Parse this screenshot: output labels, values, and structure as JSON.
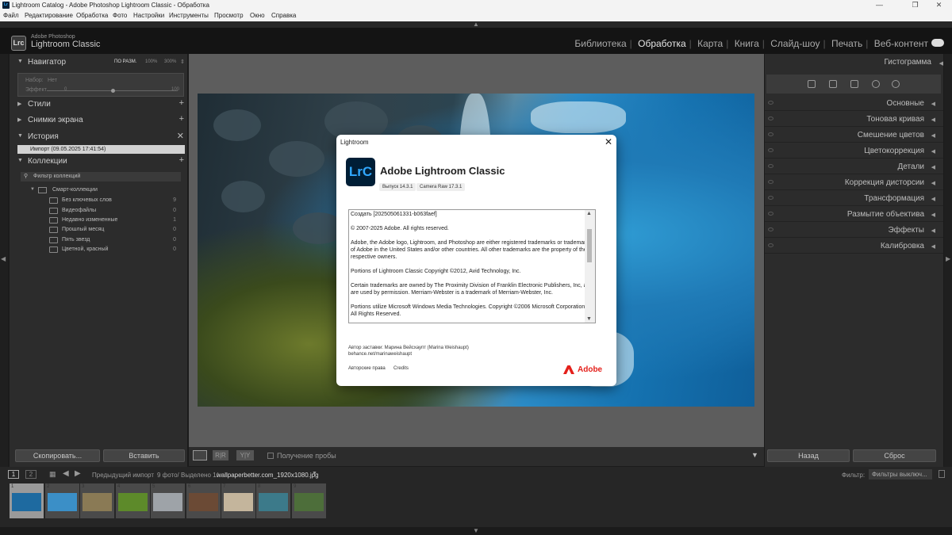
{
  "window": {
    "title": "Lightroom Catalog - Adobe Photoshop Lightroom Classic - Обработка",
    "minimize": "—",
    "maximize": "❐",
    "close": "✕"
  },
  "menu": [
    "Файл",
    "Редактирование",
    "Обработка",
    "Фото",
    "Настройки",
    "Инструменты",
    "Просмотр",
    "Окно",
    "Справка"
  ],
  "header": {
    "logo_text": "Lrc",
    "brand_line1": "Adobe Photoshop",
    "brand_line2": "Lightroom Classic",
    "modules": [
      "Библиотека",
      "Обработка",
      "Карта",
      "Книга",
      "Слайд-шоу",
      "Печать",
      "Веб-контент"
    ],
    "active_module": "Обработка",
    "separator": "|"
  },
  "left_panel": {
    "navigator": {
      "label": "Навигатор",
      "zoom_fit": "ПО РАЗМ.",
      "zoom_100": "100%",
      "zoom_300": "300%"
    },
    "preset_preview": {
      "set_label": "Набор:",
      "set_value": "Нет",
      "effect_label": "Эффект",
      "effect_min": "0",
      "effect_max": "100"
    },
    "sections": [
      {
        "label": "Стили",
        "plus": "+"
      },
      {
        "label": "Снимки экрана",
        "plus": "+"
      },
      {
        "label": "История",
        "plus": "✕"
      },
      {
        "label": "Коллекции",
        "plus": "+"
      }
    ],
    "history_item": "Импорт (09.05.2025 17:41:54)",
    "collection_filter": "Фильтр коллекций",
    "smart_collections": "Смарт-коллекции",
    "collections": [
      {
        "label": "Без ключевых слов",
        "count": "9"
      },
      {
        "label": "Видеофайлы",
        "count": "0"
      },
      {
        "label": "Недавно измененные",
        "count": "1"
      },
      {
        "label": "Прошлый месяц",
        "count": "0"
      },
      {
        "label": "Пять звезд",
        "count": "0"
      },
      {
        "label": "Цветной, красный",
        "count": "0"
      }
    ],
    "copy_button": "Скопировать...",
    "paste_button": "Вставить"
  },
  "right_panel": {
    "histogram": "Гистограмма",
    "sections": [
      "Основные",
      "Тоновая кривая",
      "Смешение цветов",
      "Цветокоррекция",
      "Детали",
      "Коррекция дисторсии",
      "Трансформация",
      "Размытие объектива",
      "Эффекты",
      "Калибровка"
    ],
    "prev_button": "Назад",
    "reset_button": "Сброс"
  },
  "toolbar": {
    "soft_proof": "Получение пробы"
  },
  "filmstrip_bar": {
    "page1": "1",
    "page2": "2",
    "source": "Предыдущий импорт",
    "info": "9 фото/ Выделено 1/",
    "filename": "wallpaperbetter.com_1920x1080.jpg",
    "filter_label": "Фильтр:",
    "filter_value": "Фильтры выключ..."
  },
  "thumbnails": [
    {
      "n": "1",
      "color": "#1e6aa0"
    },
    {
      "n": "2",
      "color": "#3b8fc7"
    },
    {
      "n": "3",
      "color": "#8a7a55"
    },
    {
      "n": "4",
      "color": "#5d8a2a"
    },
    {
      "n": "5",
      "color": "#9ea3a8"
    },
    {
      "n": "6",
      "color": "#6b4a35"
    },
    {
      "n": "7",
      "color": "#c4b59c"
    },
    {
      "n": "8",
      "color": "#3c7a8a"
    },
    {
      "n": "9",
      "color": "#4d6e3a"
    }
  ],
  "about_dialog": {
    "title": "Lightroom",
    "close": "✕",
    "icon_text": "LrC",
    "product": "Adobe Lightroom Classic",
    "version": "Выпуск 14.3.1",
    "camera_raw": "Camera Raw 17.3.1",
    "legal": [
      "Создать [202505061331-b063faef]",
      "© 2007-2025 Adobe. All rights reserved.",
      "Adobe, the Adobe logo, Lightroom, and Photoshop are either registered trademarks or trademarks of Adobe in the United States and/or other countries. All other trademarks are the property of their respective owners.",
      "Portions of Lightroom Classic Copyright ©2012, Avid Technology, Inc.",
      "Certain trademarks are owned by The Proximity Division of Franklin Electronic Publishers, Inc, and are used by permission. Merriam-Webster is a trademark of Merriam-Webster, Inc.",
      "Portions utilize Microsoft Windows Media Technologies. Copyright ©2006 Microsoft Corporation. All Rights Reserved."
    ],
    "splash_author": "Автор заставки: Марина Вейсхаупт (Marina Weishaupt)",
    "splash_link": "behance.net/marinaweishaupt",
    "copyright_link": "Авторские права",
    "credits_link": "Credits",
    "adobe": "Adobe"
  }
}
